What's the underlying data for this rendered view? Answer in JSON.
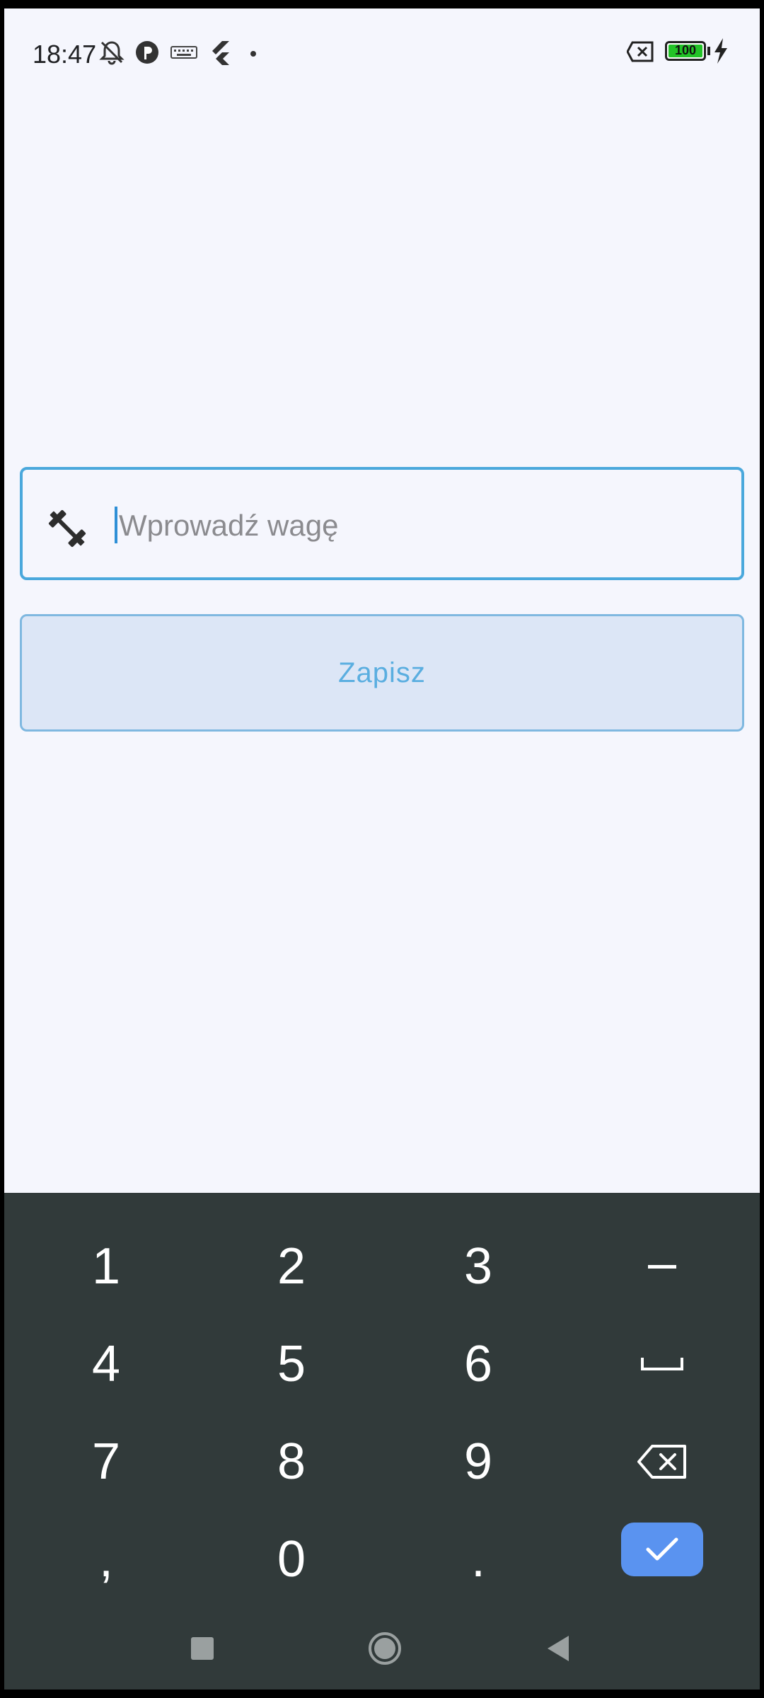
{
  "status_bar": {
    "time": "18:47",
    "battery_level": "100",
    "icons": [
      "bell-off-icon",
      "app-icon",
      "keyboard-icon",
      "flutter-icon",
      "dot-icon",
      "close-box-icon",
      "battery-icon",
      "charging-icon"
    ]
  },
  "form": {
    "weight_placeholder": "Wprowadź wagę",
    "weight_value": "",
    "save_label": "Zapisz"
  },
  "keyboard": {
    "rows": [
      [
        "1",
        "2",
        "3",
        "–"
      ],
      [
        "4",
        "5",
        "6",
        "␣"
      ],
      [
        "7",
        "8",
        "9",
        "⌫"
      ],
      [
        ",",
        "0",
        ".",
        "✓"
      ]
    ]
  },
  "colors": {
    "background": "#f5f6fd",
    "accent": "#4aa8dc",
    "button_fill": "#dce6f6",
    "keyboard_bg": "#313a3a",
    "done_key": "#5a93f0"
  },
  "nav_bar": {
    "icons": [
      "recents-icon",
      "home-icon",
      "back-icon"
    ]
  }
}
